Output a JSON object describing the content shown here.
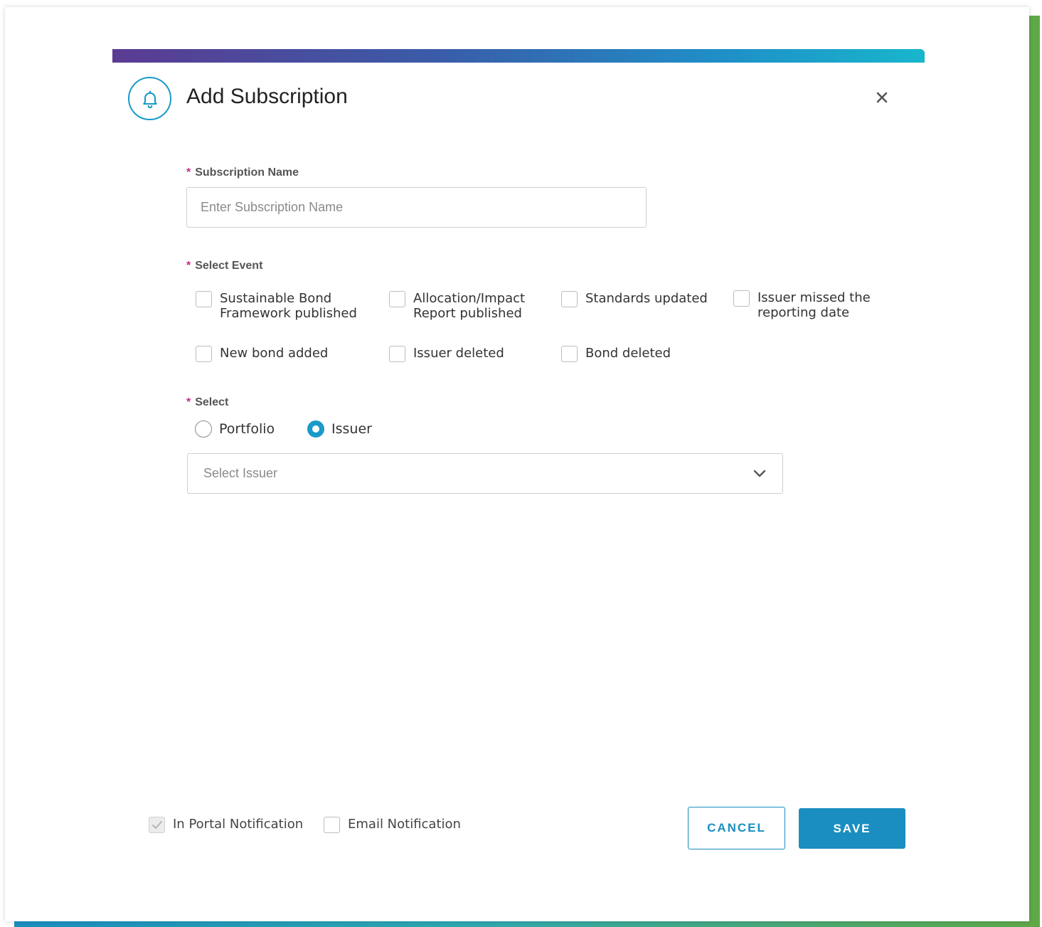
{
  "dialog": {
    "title": "Add Subscription",
    "accent_color": "#1a9ac9",
    "header_icon": "bell-icon",
    "close_icon": "close-icon"
  },
  "subscription_name": {
    "required_mark": "*",
    "label": "Subscription Name",
    "value": "",
    "placeholder": "Enter Subscription Name"
  },
  "select_event": {
    "required_mark": "*",
    "label": "Select Event",
    "options": [
      {
        "lines": [
          "Sustainable Bond",
          "Framework published"
        ],
        "checked": false
      },
      {
        "lines": [
          "Allocation/Impact",
          "Report published"
        ],
        "checked": false
      },
      {
        "lines": [
          "Standards updated"
        ],
        "checked": false
      },
      {
        "lines": [
          "Issuer missed the",
          "reporting date"
        ],
        "checked": false
      },
      {
        "lines": [
          "New bond added"
        ],
        "checked": false
      },
      {
        "lines": [
          "Issuer deleted"
        ],
        "checked": false
      },
      {
        "lines": [
          "Bond deleted"
        ],
        "checked": false
      }
    ]
  },
  "select_scope": {
    "required_mark": "*",
    "label": "Select",
    "options": [
      {
        "label": "Portfolio",
        "checked": false
      },
      {
        "label": "Issuer",
        "checked": true
      }
    ],
    "dropdown": {
      "value": "Select Issuer",
      "icon": "chevron-down-icon"
    }
  },
  "footer": {
    "in_portal_notification": {
      "label": "In Portal Notification",
      "checked": true,
      "disabled": true
    },
    "email_notification": {
      "label": "Email Notification",
      "checked": false
    },
    "cancel_label": "CANCEL",
    "save_label": "SAVE"
  }
}
